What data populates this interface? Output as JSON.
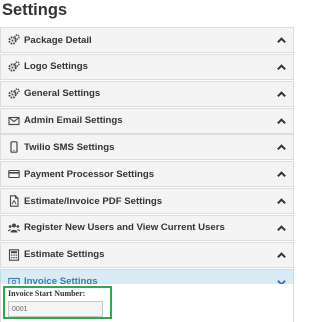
{
  "page_title": "Settings",
  "sections": [
    {
      "label": "Package Detail",
      "icon": "cogs-icon",
      "expanded": false
    },
    {
      "label": "Logo Settings",
      "icon": "cogs-icon",
      "expanded": false
    },
    {
      "label": "General Settings",
      "icon": "cogs-icon",
      "expanded": false
    },
    {
      "label": "Admin Email Settings",
      "icon": "envelope-icon",
      "expanded": false
    },
    {
      "label": "Twilio SMS Settings",
      "icon": "mobile-icon",
      "expanded": false
    },
    {
      "label": "Payment Processor Settings",
      "icon": "credit-card-icon",
      "expanded": false
    },
    {
      "label": "Estimate/Invoice PDF Settings",
      "icon": "pdf-file-icon",
      "expanded": false
    },
    {
      "label": "Register New Users and View Current Users",
      "icon": "users-icon",
      "expanded": false
    },
    {
      "label": "Estimate Settings",
      "icon": "calculator-icon",
      "expanded": false
    },
    {
      "label": "Invoice Settings",
      "icon": "money-icon",
      "expanded": true
    }
  ],
  "invoice_panel": {
    "start_number_label": "Invoice Start Number:",
    "start_number_value": "0001"
  },
  "colors": {
    "header_bg": "#f4f4f4",
    "active_bg": "#d9ebf5",
    "active_text": "#3a78b0",
    "highlight_border": "#2fa84f"
  }
}
